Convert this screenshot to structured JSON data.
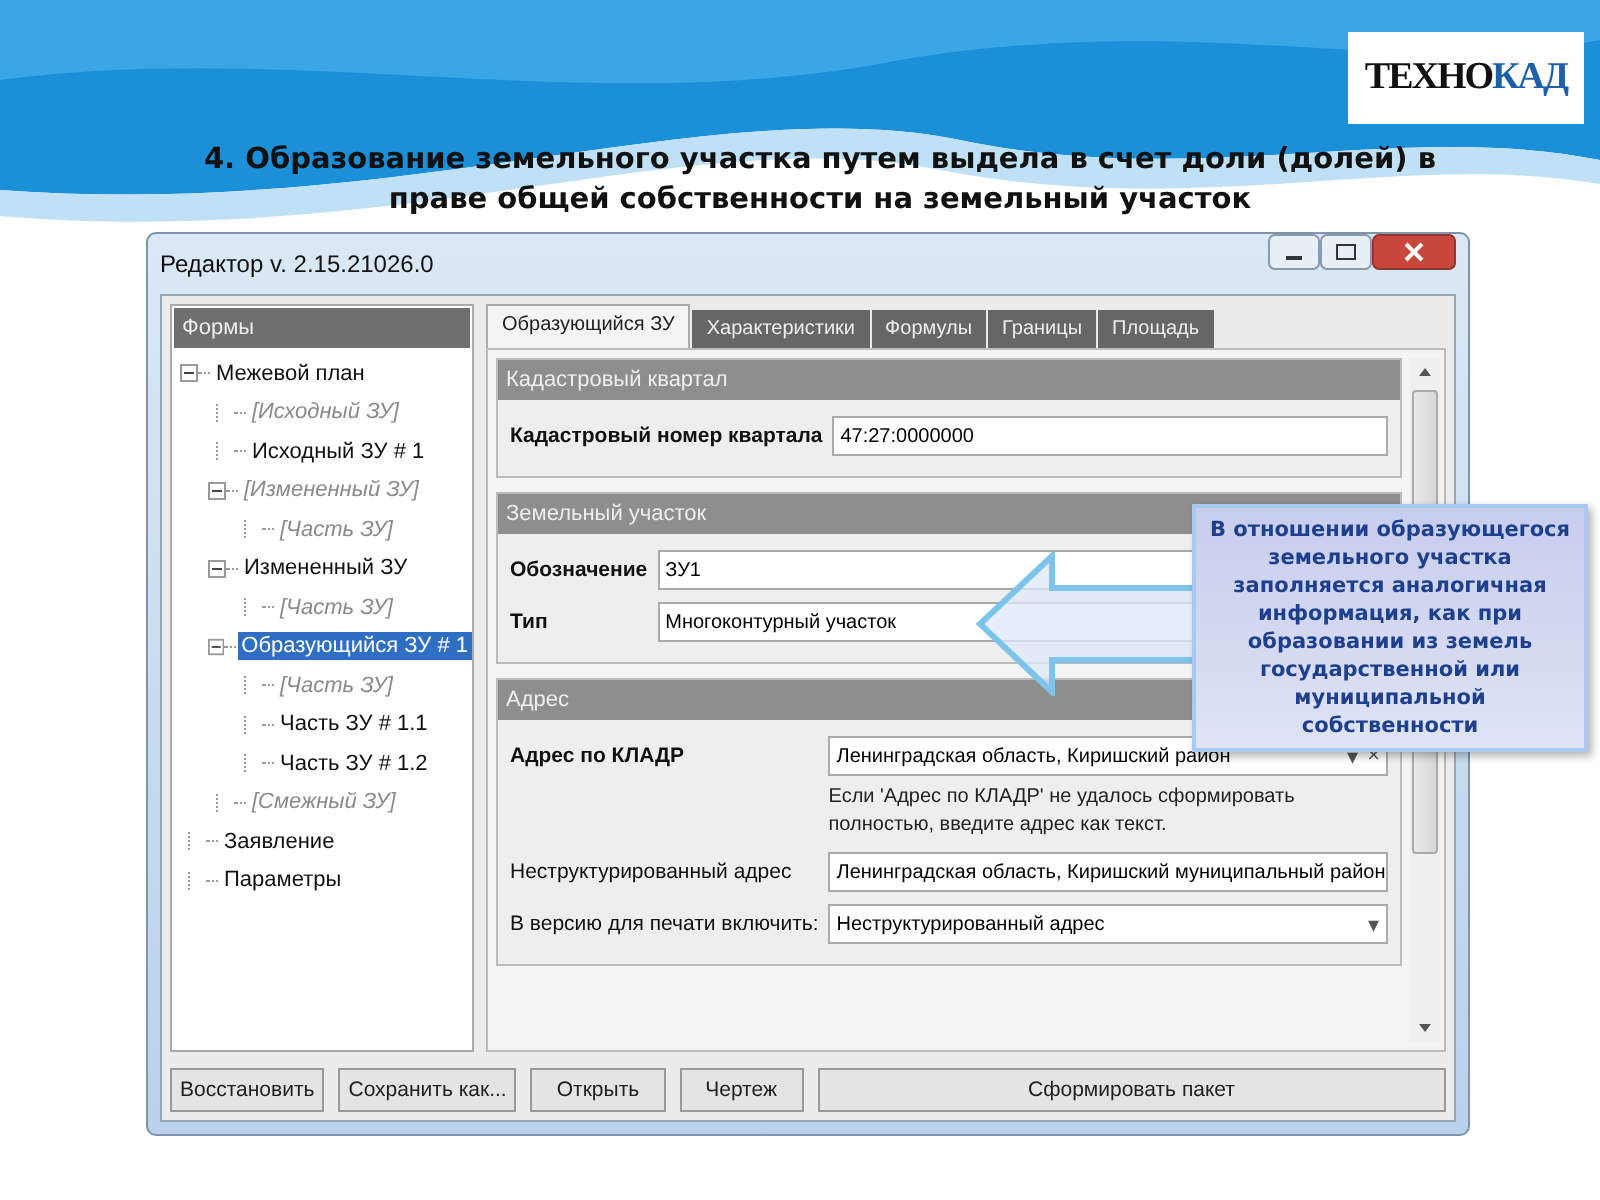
{
  "logo": {
    "part1": "ТЕХНО",
    "part2": "КАД"
  },
  "title": "4.  Образование земельного участка путем выдела в счет доли (долей) в праве общей собственности на земельный участок",
  "window": {
    "title": "Редактор v. 2.15.21026.0"
  },
  "sidebar": {
    "header": "Формы",
    "items": [
      {
        "label": "Межевой план",
        "kind": "entry",
        "selected": false,
        "expanded": true,
        "children": [
          {
            "label": "[Исходный ЗУ]",
            "kind": "template",
            "selected": false
          },
          {
            "label": "Исходный ЗУ # 1",
            "kind": "entry",
            "selected": false
          },
          {
            "label": "[Измененный ЗУ]",
            "kind": "template",
            "selected": false,
            "expanded": true,
            "children": [
              {
                "label": "[Часть ЗУ]",
                "kind": "template",
                "selected": false
              }
            ]
          },
          {
            "label": "Измененный ЗУ",
            "kind": "entry",
            "selected": false,
            "expanded": true,
            "children": [
              {
                "label": "[Часть ЗУ]",
                "kind": "template",
                "selected": false
              }
            ]
          },
          {
            "label": "Образующийся ЗУ # 1",
            "kind": "entry",
            "selected": true,
            "expanded": true,
            "children": [
              {
                "label": "[Часть ЗУ]",
                "kind": "template",
                "selected": false
              },
              {
                "label": "Часть ЗУ # 1.1",
                "kind": "entry",
                "selected": false
              },
              {
                "label": "Часть ЗУ # 1.2",
                "kind": "entry",
                "selected": false
              }
            ]
          },
          {
            "label": "[Смежный ЗУ]",
            "kind": "template",
            "selected": false
          }
        ]
      },
      {
        "label": "Заявление",
        "kind": "entry",
        "selected": false
      },
      {
        "label": "Параметры",
        "kind": "entry",
        "selected": false
      }
    ]
  },
  "tabs": [
    {
      "label": "Образующийся ЗУ",
      "selected": true
    },
    {
      "label": "Характеристики",
      "selected": false
    },
    {
      "label": "Формулы",
      "selected": false
    },
    {
      "label": "Границы",
      "selected": false
    },
    {
      "label": "Площадь",
      "selected": false
    }
  ],
  "sections": [
    {
      "title": "Кадастровый квартал",
      "fields": [
        {
          "kind": "text",
          "label": "Кадастровый номер квартала",
          "bold_label": true,
          "value": "47:27:0000000"
        }
      ]
    },
    {
      "title": "Земельный участок",
      "fields": [
        {
          "kind": "text",
          "label": "Обозначение",
          "bold_label": true,
          "value": "ЗУ1"
        },
        {
          "kind": "text",
          "label": "Тип",
          "bold_label": true,
          "value": "Многоконтурный участок"
        }
      ]
    },
    {
      "title": "Адрес",
      "fields": [
        {
          "kind": "combo-clear",
          "label": "Адрес по КЛАДР",
          "bold_label": true,
          "value": "Ленинградская область, Киришский район",
          "caret": "▾",
          "clear": "×"
        },
        {
          "kind": "note",
          "text": "Если 'Адрес по КЛАДР' не удалось сформировать полностью, введите адрес как текст."
        },
        {
          "kind": "text",
          "label": "Неструктурированный адрес",
          "bold_label": false,
          "value": "Ленинградская область, Киришский муниципальный район"
        },
        {
          "kind": "combo",
          "label": "В версию для печати включить:",
          "bold_label": false,
          "value": "Неструктурированный адрес",
          "caret": "▾"
        }
      ]
    }
  ],
  "buttons": [
    {
      "label": "Восстановить",
      "kind": "normal"
    },
    {
      "label": "Сохранить как...",
      "kind": "normal"
    },
    {
      "label": "Открыть",
      "kind": "normal"
    },
    {
      "label": "Чертеж",
      "kind": "normal"
    },
    {
      "label": "Сформировать пакет",
      "kind": "wide"
    }
  ],
  "callout": {
    "text": "В отношении образующегося земельного участка заполняется аналогичная информация, как при образовании из земель государственной или муниципальной собственности"
  }
}
